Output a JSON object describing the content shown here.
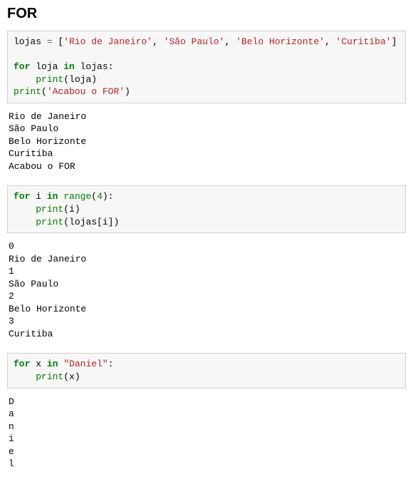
{
  "heading": "FOR",
  "cells": [
    {
      "tokens": [
        {
          "t": "lojas ",
          "c": "n"
        },
        {
          "t": "=",
          "c": "o"
        },
        {
          "t": " [",
          "c": "p"
        },
        {
          "t": "'Rio de Janeiro'",
          "c": "s"
        },
        {
          "t": ", ",
          "c": "p"
        },
        {
          "t": "'São Paulo'",
          "c": "s"
        },
        {
          "t": ", ",
          "c": "p"
        },
        {
          "t": "'Belo Horizonte'",
          "c": "s"
        },
        {
          "t": ", ",
          "c": "p"
        },
        {
          "t": "'Curitiba'",
          "c": "s"
        },
        {
          "t": "]",
          "c": "p"
        },
        {
          "t": "\n",
          "c": "p"
        },
        {
          "t": "\n",
          "c": "p"
        },
        {
          "t": "for",
          "c": "k"
        },
        {
          "t": " loja ",
          "c": "n"
        },
        {
          "t": "in",
          "c": "k"
        },
        {
          "t": " lojas:",
          "c": "n"
        },
        {
          "t": "\n",
          "c": "p"
        },
        {
          "t": "    ",
          "c": "p"
        },
        {
          "t": "print",
          "c": "f"
        },
        {
          "t": "(loja)",
          "c": "p"
        },
        {
          "t": "\n",
          "c": "p"
        },
        {
          "t": "print",
          "c": "f"
        },
        {
          "t": "(",
          "c": "p"
        },
        {
          "t": "'Acabou o FOR'",
          "c": "s"
        },
        {
          "t": ")",
          "c": "p"
        }
      ],
      "output": "Rio de Janeiro\nSão Paulo\nBelo Horizonte\nCuritiba\nAcabou o FOR"
    },
    {
      "tokens": [
        {
          "t": "for",
          "c": "k"
        },
        {
          "t": " i ",
          "c": "n"
        },
        {
          "t": "in",
          "c": "k"
        },
        {
          "t": " ",
          "c": "p"
        },
        {
          "t": "range",
          "c": "f"
        },
        {
          "t": "(",
          "c": "p"
        },
        {
          "t": "4",
          "c": "m"
        },
        {
          "t": "):",
          "c": "p"
        },
        {
          "t": "\n",
          "c": "p"
        },
        {
          "t": "    ",
          "c": "p"
        },
        {
          "t": "print",
          "c": "f"
        },
        {
          "t": "(i)",
          "c": "p"
        },
        {
          "t": "\n",
          "c": "p"
        },
        {
          "t": "    ",
          "c": "p"
        },
        {
          "t": "print",
          "c": "f"
        },
        {
          "t": "(lojas[i])",
          "c": "p"
        }
      ],
      "output": "0\nRio de Janeiro\n1\nSão Paulo\n2\nBelo Horizonte\n3\nCuritiba"
    },
    {
      "tokens": [
        {
          "t": "for",
          "c": "k"
        },
        {
          "t": " x ",
          "c": "n"
        },
        {
          "t": "in",
          "c": "k"
        },
        {
          "t": " ",
          "c": "p"
        },
        {
          "t": "\"Daniel\"",
          "c": "s"
        },
        {
          "t": ":",
          "c": "p"
        },
        {
          "t": "\n",
          "c": "p"
        },
        {
          "t": "    ",
          "c": "p"
        },
        {
          "t": "print",
          "c": "f"
        },
        {
          "t": "(x)",
          "c": "p"
        }
      ],
      "output": "D\na\nn\ni\ne\nl"
    }
  ]
}
